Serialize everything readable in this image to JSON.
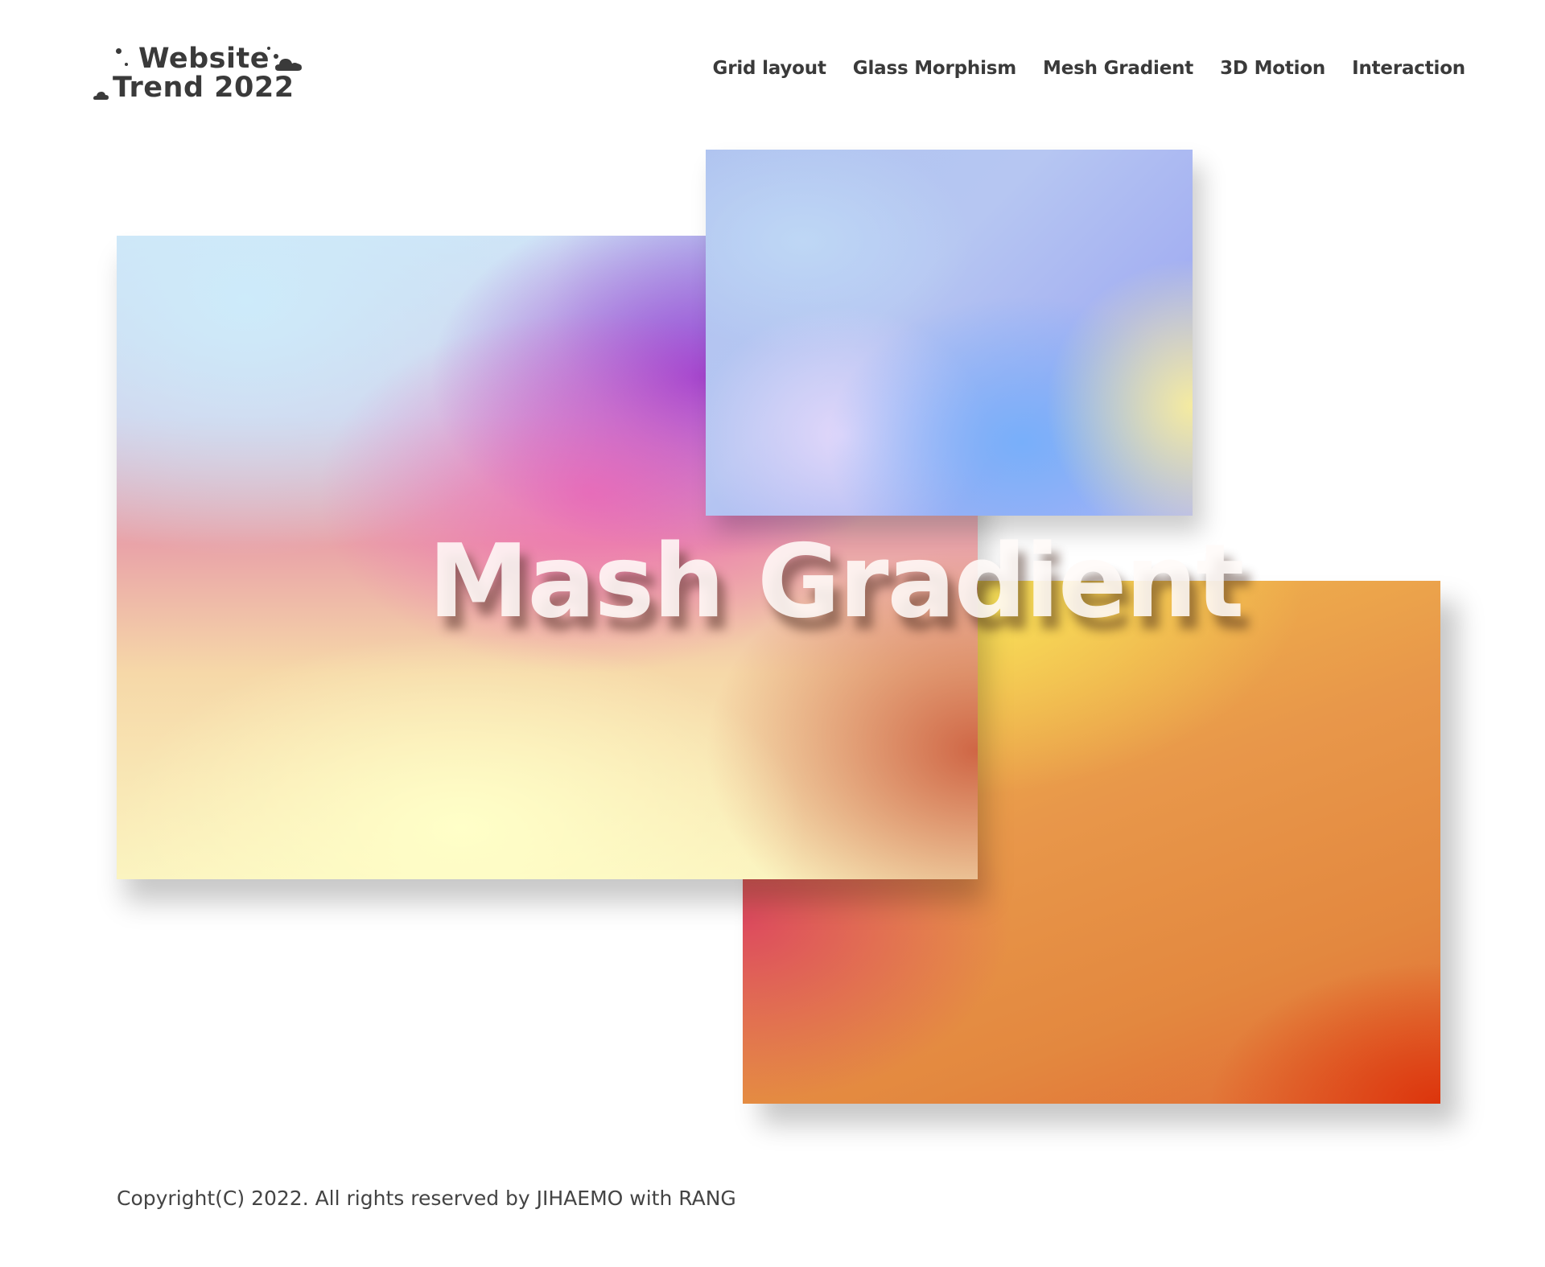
{
  "header": {
    "logo": {
      "line1": "Website",
      "line2": "Trend 2022"
    },
    "nav": [
      {
        "label": "Grid layout"
      },
      {
        "label": "Glass Morphism"
      },
      {
        "label": "Mesh Gradient"
      },
      {
        "label": "3D Motion"
      },
      {
        "label": "Interaction"
      }
    ]
  },
  "hero": {
    "title": "Mash Gradient"
  },
  "footer": {
    "copyright": "Copyright(C) 2022. All rights reserved by JIHAEMO with RANG"
  },
  "icons": {
    "logo_decorations": [
      "dot-icon",
      "cloud-icon"
    ]
  },
  "colors": {
    "text": "#3a3a3a",
    "background": "#ffffff",
    "gradient_blue": "#a4b0f2",
    "gradient_purple": "#963cd2",
    "gradient_orange": "#e3883f",
    "gradient_yellow": "#fae85a",
    "gradient_red": "#dc320a"
  }
}
